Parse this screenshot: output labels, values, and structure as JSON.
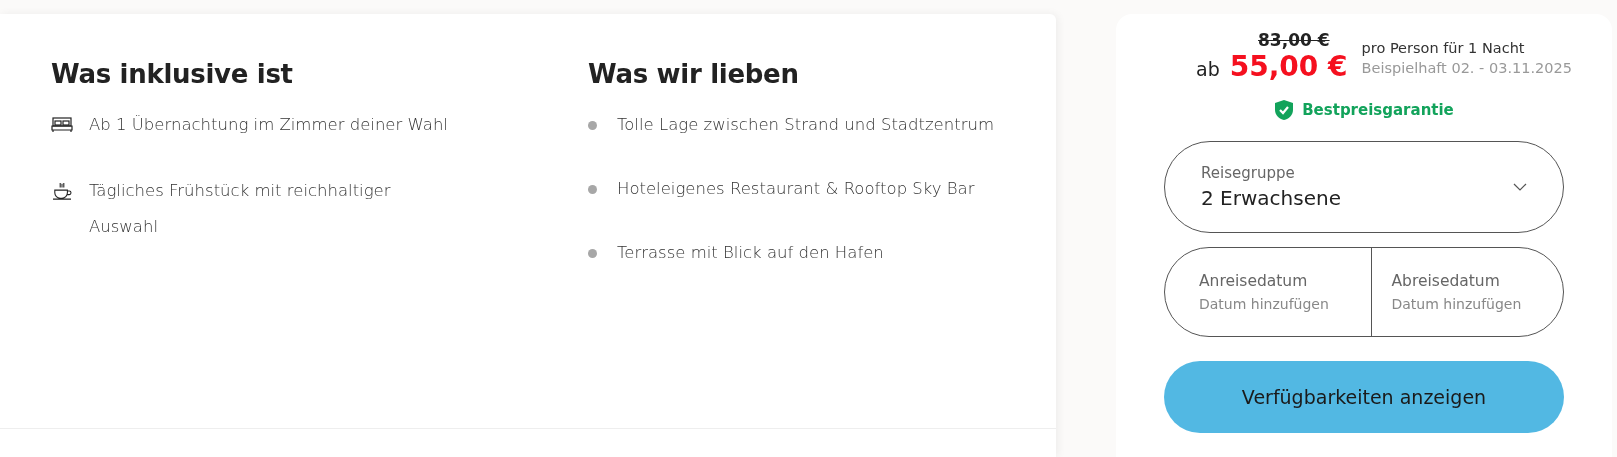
{
  "inclusive": {
    "title": "Was inklusive ist",
    "items": [
      {
        "kind": "bed",
        "text": "Ab 1 Übernachtung im Zimmer deiner Wahl"
      },
      {
        "kind": "cup",
        "text": "Tägliches Frühstück mit reichhaltiger Auswahl"
      }
    ]
  },
  "loves": {
    "title": "Was wir lieben",
    "items": [
      "Tolle Lage zwischen Strand und Stadtzentrum",
      "Hoteleigenes Restaurant & Rooftop Sky Bar",
      "Terrasse mit Blick auf den Hafen"
    ]
  },
  "booking": {
    "old_price": "83,00 €",
    "prefix": "ab",
    "price": "55,00 €",
    "per": "pro Person für 1 Nacht",
    "example": "Beispielhaft 02. - 03.11.2025",
    "guarantee": "Bestpreisgarantie",
    "group": {
      "label": "Reisegruppe",
      "value": "2 Erwachsene"
    },
    "dates": [
      {
        "label": "Anreisedatum",
        "placeholder": "Datum hinzufügen"
      },
      {
        "label": "Abreisedatum",
        "placeholder": "Datum hinzufügen"
      }
    ],
    "button": "Verfügbarkeiten anzeigen"
  }
}
